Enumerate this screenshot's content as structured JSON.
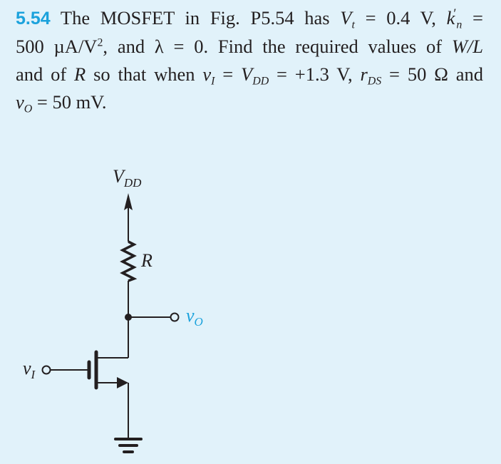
{
  "problem": {
    "number": "5.54",
    "line1": {
      "t1": "The MOSFET in Fig. P5.54 has ",
      "vt_symbol": "V",
      "vt_sub": "t",
      "t2": " = 0.4 V, ",
      "kn_symbol": "k",
      "kn_prime": "′",
      "kn_sub": "n",
      "t3": " ="
    },
    "line2": {
      "t1": "500 µA/V",
      "sup": "2",
      "t2": ", and λ = 0. Find the required values of ",
      "wl": "W/L"
    },
    "line3": {
      "t1": "and of ",
      "r": "R",
      "t2": " so that when ",
      "vi_symbol": "v",
      "vi_sub": "I",
      "t3": " = ",
      "vdd_symbol": "V",
      "vdd_sub": "DD",
      "t4": " = +1.3 V, ",
      "rds_symbol": "r",
      "rds_sub": "DS",
      "t5": " = 50 Ω and"
    },
    "line4": {
      "vo_symbol": "v",
      "vo_sub": "O",
      "t1": " = 50 mV."
    }
  },
  "figure": {
    "vdd_label": "V",
    "vdd_sub": "DD",
    "resistor_label": "R",
    "output_label": "v",
    "output_sub": "O",
    "input_label": "v",
    "input_sub": "I"
  },
  "colors": {
    "background": "#e1f2fa",
    "accent": "#1ba2dc",
    "ink": "#231f20"
  }
}
